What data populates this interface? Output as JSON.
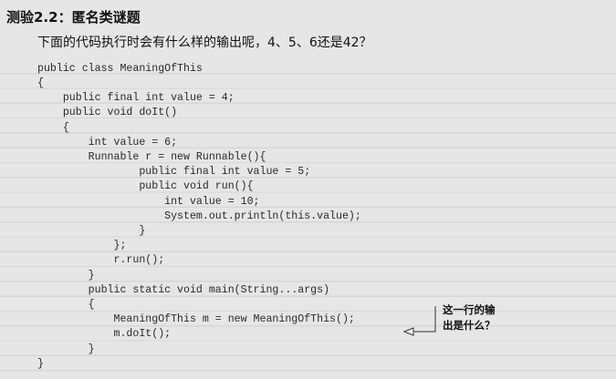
{
  "quiz": {
    "title": "测验2.2：匿名类谜题",
    "question": "下面的代码执行时会有什么样的输出呢，4、5、6还是42？"
  },
  "code_lines": [
    "public class MeaningOfThis",
    "{",
    "    public final int value = 4;",
    "    public void doIt()",
    "    {",
    "        int value = 6;",
    "        Runnable r = new Runnable(){",
    "                public final int value = 5;",
    "                public void run(){",
    "                    int value = 10;",
    "                    System.out.println(this.value);",
    "                }",
    "            };",
    "            r.run();",
    "        }",
    "        public static void main(String...args)",
    "        {",
    "            MeaningOfThis m = new MeaningOfThis();",
    "            m.doIt();",
    "        }",
    "}"
  ],
  "annotation": {
    "line1": "这一行的输",
    "line2": "出是什么？"
  }
}
